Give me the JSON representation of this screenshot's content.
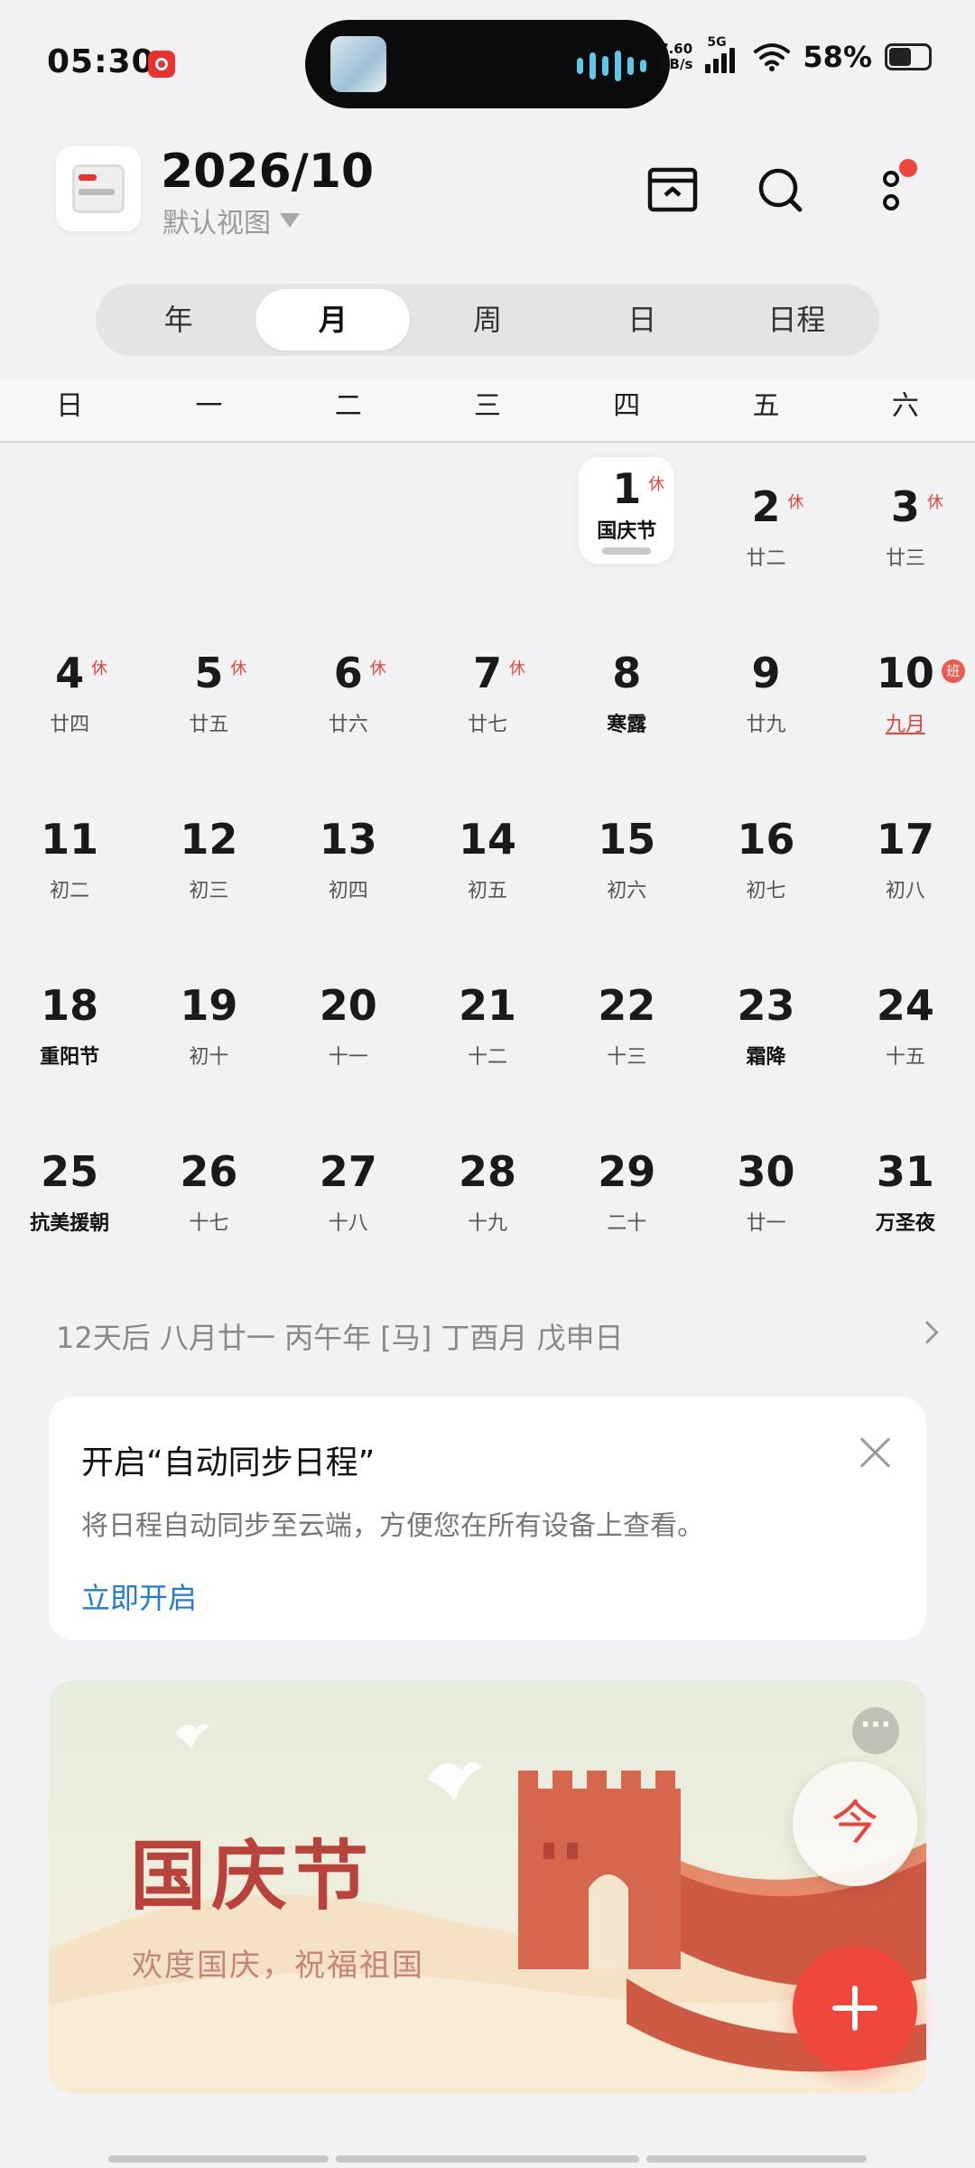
{
  "status_bar": {
    "time": "05:30",
    "net_speed_value": "7.60",
    "net_speed_unit": "KB/s",
    "signal_label": "5G",
    "battery_percent": "58%"
  },
  "header": {
    "title": "2026/10",
    "view_label": "默认视图"
  },
  "segments": [
    {
      "label": "年",
      "active": false
    },
    {
      "label": "月",
      "active": true
    },
    {
      "label": "周",
      "active": false
    },
    {
      "label": "日",
      "active": false
    },
    {
      "label": "日程",
      "active": false
    }
  ],
  "weekdays": [
    "日",
    "一",
    "二",
    "三",
    "四",
    "五",
    "六"
  ],
  "calendar": {
    "weeks": [
      [
        {
          "num": "",
          "sub": ""
        },
        {
          "num": "",
          "sub": ""
        },
        {
          "num": "",
          "sub": ""
        },
        {
          "num": "",
          "sub": ""
        },
        {
          "num": "1",
          "sub": "国庆节",
          "badge": "休",
          "today": true,
          "fest": true
        },
        {
          "num": "2",
          "sub": "廿二",
          "badge": "休"
        },
        {
          "num": "3",
          "sub": "廿三",
          "badge": "休"
        }
      ],
      [
        {
          "num": "4",
          "sub": "廿四",
          "badge": "休"
        },
        {
          "num": "5",
          "sub": "廿五",
          "badge": "休"
        },
        {
          "num": "6",
          "sub": "廿六",
          "badge": "休"
        },
        {
          "num": "7",
          "sub": "廿七",
          "badge": "休"
        },
        {
          "num": "8",
          "sub": "寒露",
          "fest": true
        },
        {
          "num": "9",
          "sub": "廿九"
        },
        {
          "num": "10",
          "sub": "九月",
          "work": "班",
          "under": true
        }
      ],
      [
        {
          "num": "11",
          "sub": "初二"
        },
        {
          "num": "12",
          "sub": "初三"
        },
        {
          "num": "13",
          "sub": "初四"
        },
        {
          "num": "14",
          "sub": "初五"
        },
        {
          "num": "15",
          "sub": "初六"
        },
        {
          "num": "16",
          "sub": "初七"
        },
        {
          "num": "17",
          "sub": "初八"
        }
      ],
      [
        {
          "num": "18",
          "sub": "重阳节",
          "fest": true
        },
        {
          "num": "19",
          "sub": "初十"
        },
        {
          "num": "20",
          "sub": "十一"
        },
        {
          "num": "21",
          "sub": "十二"
        },
        {
          "num": "22",
          "sub": "十三"
        },
        {
          "num": "23",
          "sub": "霜降",
          "fest": true
        },
        {
          "num": "24",
          "sub": "十五"
        }
      ],
      [
        {
          "num": "25",
          "sub": "抗美援朝",
          "fest": true
        },
        {
          "num": "26",
          "sub": "十七"
        },
        {
          "num": "27",
          "sub": "十八"
        },
        {
          "num": "28",
          "sub": "十九"
        },
        {
          "num": "29",
          "sub": "二十"
        },
        {
          "num": "30",
          "sub": "廿一"
        },
        {
          "num": "31",
          "sub": "万圣夜",
          "fest": true
        }
      ]
    ]
  },
  "lunar_info": "12天后 八月廿一 丙午年 [马] 丁酉月 戊申日",
  "sync_card": {
    "title": "开启“自动同步日程”",
    "description": "将日程自动同步至云端，方便您在所有设备上查看。",
    "action": "立即开启"
  },
  "banner": {
    "title": "国庆节",
    "subtitle": "欢度国庆，祝福祖国",
    "more": "···"
  },
  "fab": {
    "today_label": "今"
  },
  "icons": {
    "archive": "archive-icon",
    "search": "search-icon",
    "more": "more-vertical-icon",
    "close": "close-icon",
    "add": "plus-icon"
  },
  "colors": {
    "accent": "#f0473c",
    "link": "#1f7ad8",
    "holiday_badge": "#e0453a"
  }
}
